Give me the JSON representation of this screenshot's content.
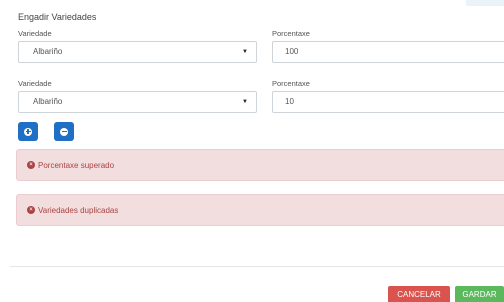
{
  "form": {
    "title": "Engadir Variedades",
    "rows": [
      {
        "variety_label": "Variedade",
        "variety_value": "Albariño",
        "percent_label": "Porcentaxe",
        "percent_value": "100"
      },
      {
        "variety_label": "Variedade",
        "variety_value": "Albariño",
        "percent_label": "Porcentaxe",
        "percent_value": "10"
      }
    ]
  },
  "alerts": [
    {
      "text": "Porcentaxe superado",
      "color": "#a94442"
    },
    {
      "text": "Variedades duplicadas",
      "color": "#a94442"
    }
  ],
  "buttons": {
    "add_icon": "plus-circle-icon",
    "remove_icon": "minus-circle-icon",
    "cancel_label": "CANCELAR",
    "save_label": "GARDAR"
  },
  "colors": {
    "primary": "#1f6fc5",
    "danger": "#d9534f",
    "success": "#5cb85c",
    "alert_bg": "#f2dede"
  }
}
